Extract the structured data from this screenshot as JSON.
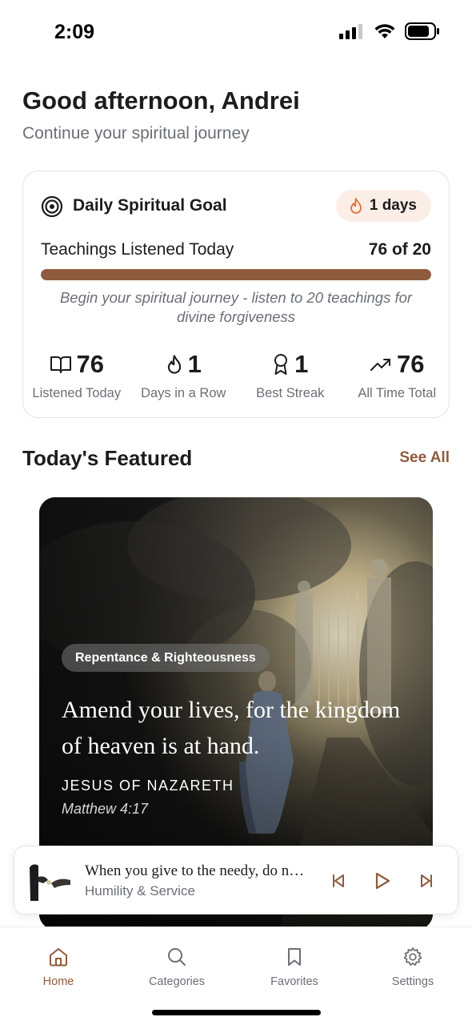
{
  "status_bar": {
    "time": "2:09"
  },
  "header": {
    "greeting": "Good afternoon, Andrei",
    "subtitle": "Continue your spiritual journey"
  },
  "goal_card": {
    "title": "Daily Spiritual Goal",
    "icon": "target-icon",
    "streak_badge": "1 days",
    "progress_label": "Teachings Listened Today",
    "progress_count": "76 of 20",
    "progress_fraction": 1.0,
    "message": "Begin your spiritual journey - listen to 20 teachings for divine forgiveness",
    "stats": [
      {
        "icon": "book-icon",
        "value": "76",
        "label": "Listened Today"
      },
      {
        "icon": "flame-icon",
        "value": "1",
        "label": "Days in a Row"
      },
      {
        "icon": "award-icon",
        "value": "1",
        "label": "Best Streak"
      },
      {
        "icon": "trending-up-icon",
        "value": "76",
        "label": "All Time Total"
      }
    ]
  },
  "featured": {
    "section_title": "Today's Featured",
    "see_all": "See All",
    "card": {
      "category": "Repentance & Righteousness",
      "quote": "Amend your lives, for the kingdom of heaven is at hand.",
      "author": "JESUS OF NAZARETH",
      "reference": "Matthew 4:17"
    }
  },
  "mini_player": {
    "title": "When you give to the needy, do n…",
    "subtitle": "Humility & Service",
    "controls": [
      "skip-back-icon",
      "play-icon",
      "skip-forward-icon"
    ]
  },
  "tab_bar": {
    "tabs": [
      {
        "icon": "home-icon",
        "label": "Home",
        "active": true
      },
      {
        "icon": "search-icon",
        "label": "Categories",
        "active": false
      },
      {
        "icon": "bookmark-icon",
        "label": "Favorites",
        "active": false
      },
      {
        "icon": "gear-icon",
        "label": "Settings",
        "active": false
      }
    ]
  },
  "colors": {
    "accent": "#8f5b3e",
    "badge_bg": "#fbeee6",
    "flame": "#e0703a",
    "muted_text": "#6b6f76"
  }
}
